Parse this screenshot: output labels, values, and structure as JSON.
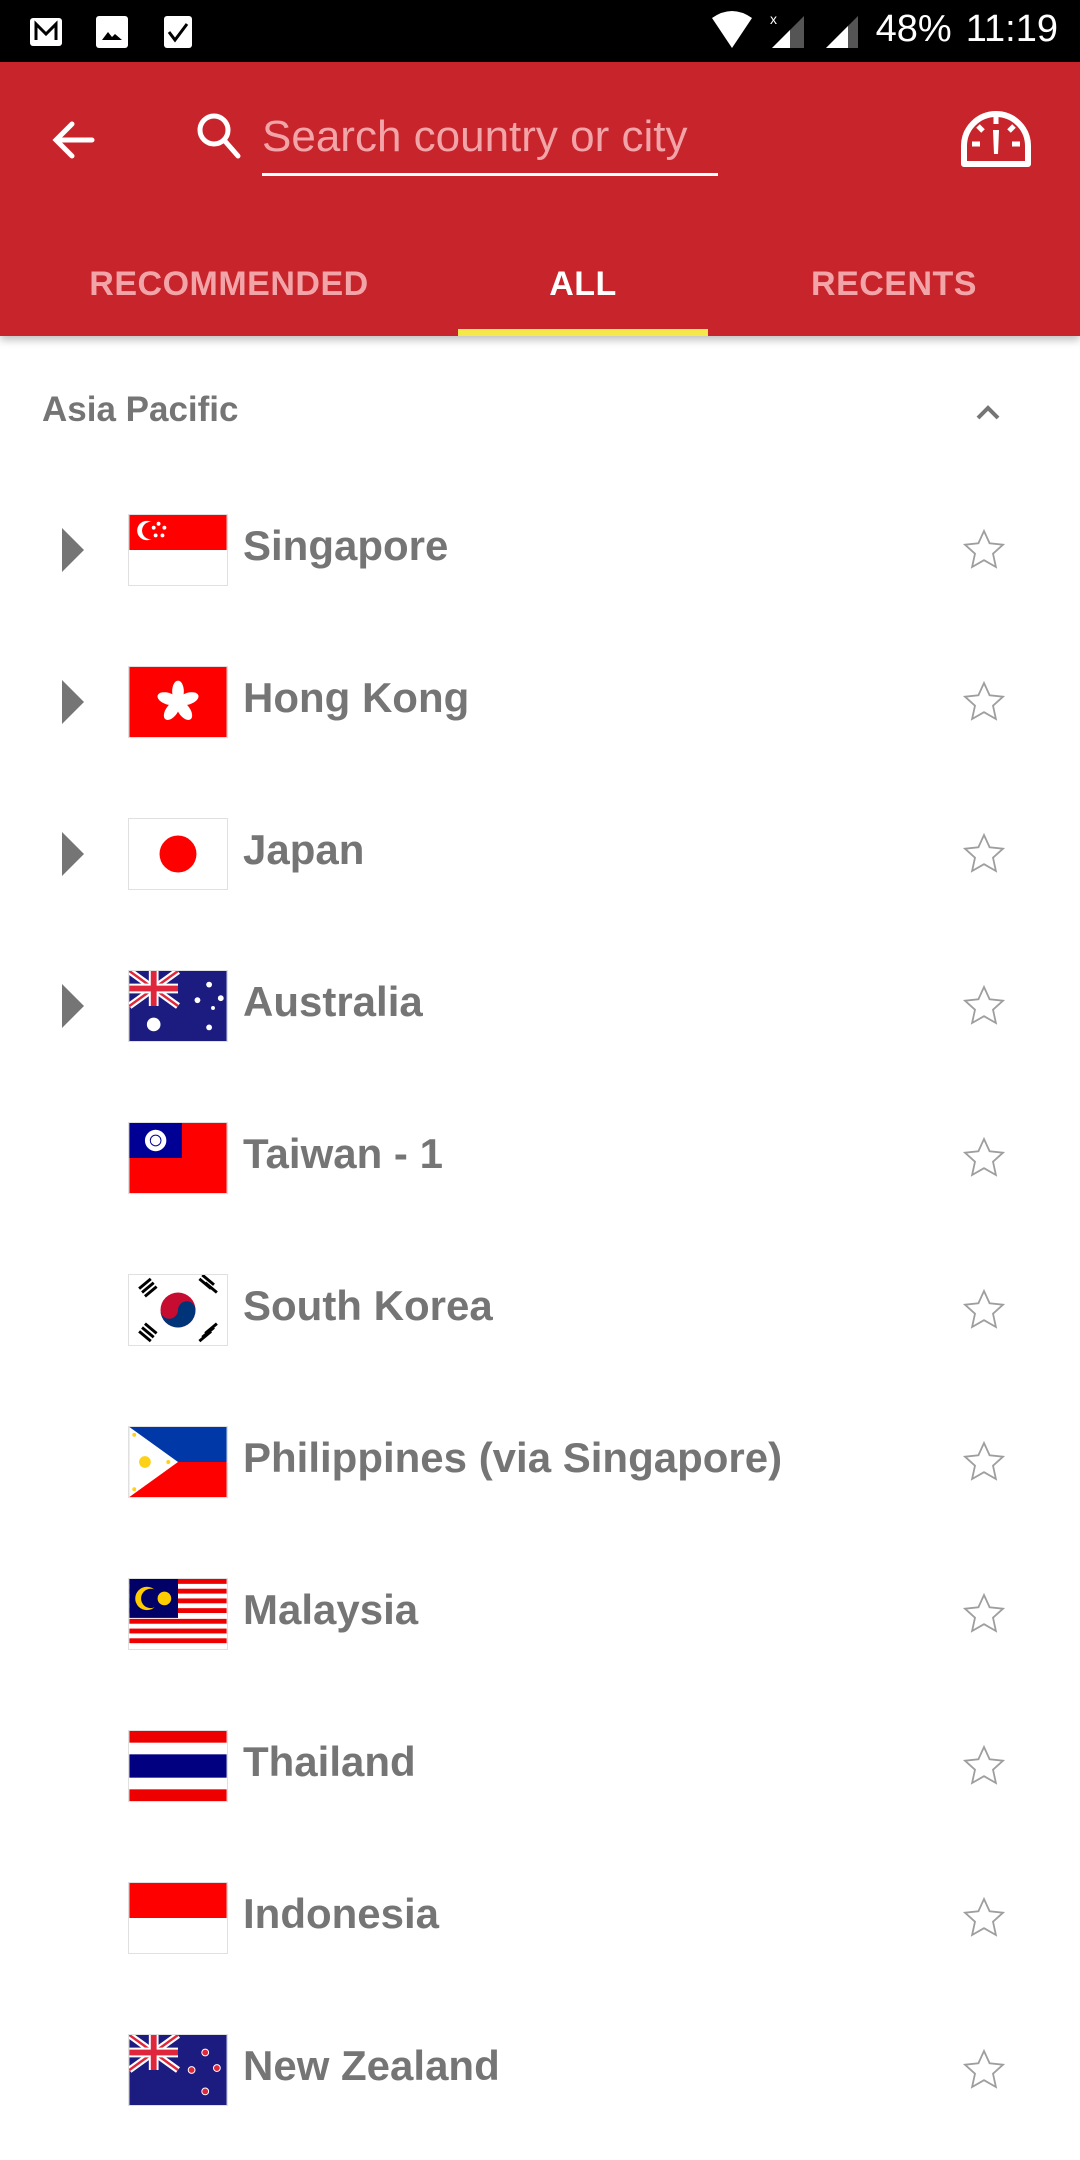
{
  "status_bar": {
    "left_icons": [
      "gmail-icon",
      "gallery-icon",
      "tasks-icon"
    ],
    "right_icons": [
      "wifi-icon",
      "mobile-signal-no-data-icon",
      "signal-icon"
    ],
    "battery": "48%",
    "time": "11:19"
  },
  "appbar": {
    "back_icon": "arrow-back-icon",
    "search_icon": "search-icon",
    "search_placeholder": "Search country or city",
    "search_value": "",
    "speed_test_icon": "speedometer-icon",
    "accent_color": "#c8242c",
    "indicator_color": "#f5e84a"
  },
  "tabs": [
    {
      "label": "RECOMMENDED",
      "active": false
    },
    {
      "label": "ALL",
      "active": true
    },
    {
      "label": "RECENTS",
      "active": false
    }
  ],
  "section": {
    "title": "Asia Pacific",
    "expanded": true,
    "toggle_icon": "chevron-up-icon"
  },
  "countries": [
    {
      "name": "Singapore",
      "flag": "singapore",
      "expandable": true,
      "favorite": false
    },
    {
      "name": "Hong Kong",
      "flag": "hong-kong",
      "expandable": true,
      "favorite": false
    },
    {
      "name": "Japan",
      "flag": "japan",
      "expandable": true,
      "favorite": false
    },
    {
      "name": "Australia",
      "flag": "australia",
      "expandable": true,
      "favorite": false
    },
    {
      "name": "Taiwan - 1",
      "flag": "taiwan",
      "expandable": false,
      "favorite": false
    },
    {
      "name": "South Korea",
      "flag": "south-korea",
      "expandable": false,
      "favorite": false
    },
    {
      "name": "Philippines (via Singapore)",
      "flag": "philippines",
      "expandable": false,
      "favorite": false
    },
    {
      "name": "Malaysia",
      "flag": "malaysia",
      "expandable": false,
      "favorite": false
    },
    {
      "name": "Thailand",
      "flag": "thailand",
      "expandable": false,
      "favorite": false
    },
    {
      "name": "Indonesia",
      "flag": "indonesia",
      "expandable": false,
      "favorite": false
    },
    {
      "name": "New Zealand",
      "flag": "new-zealand",
      "expandable": false,
      "favorite": false
    }
  ]
}
